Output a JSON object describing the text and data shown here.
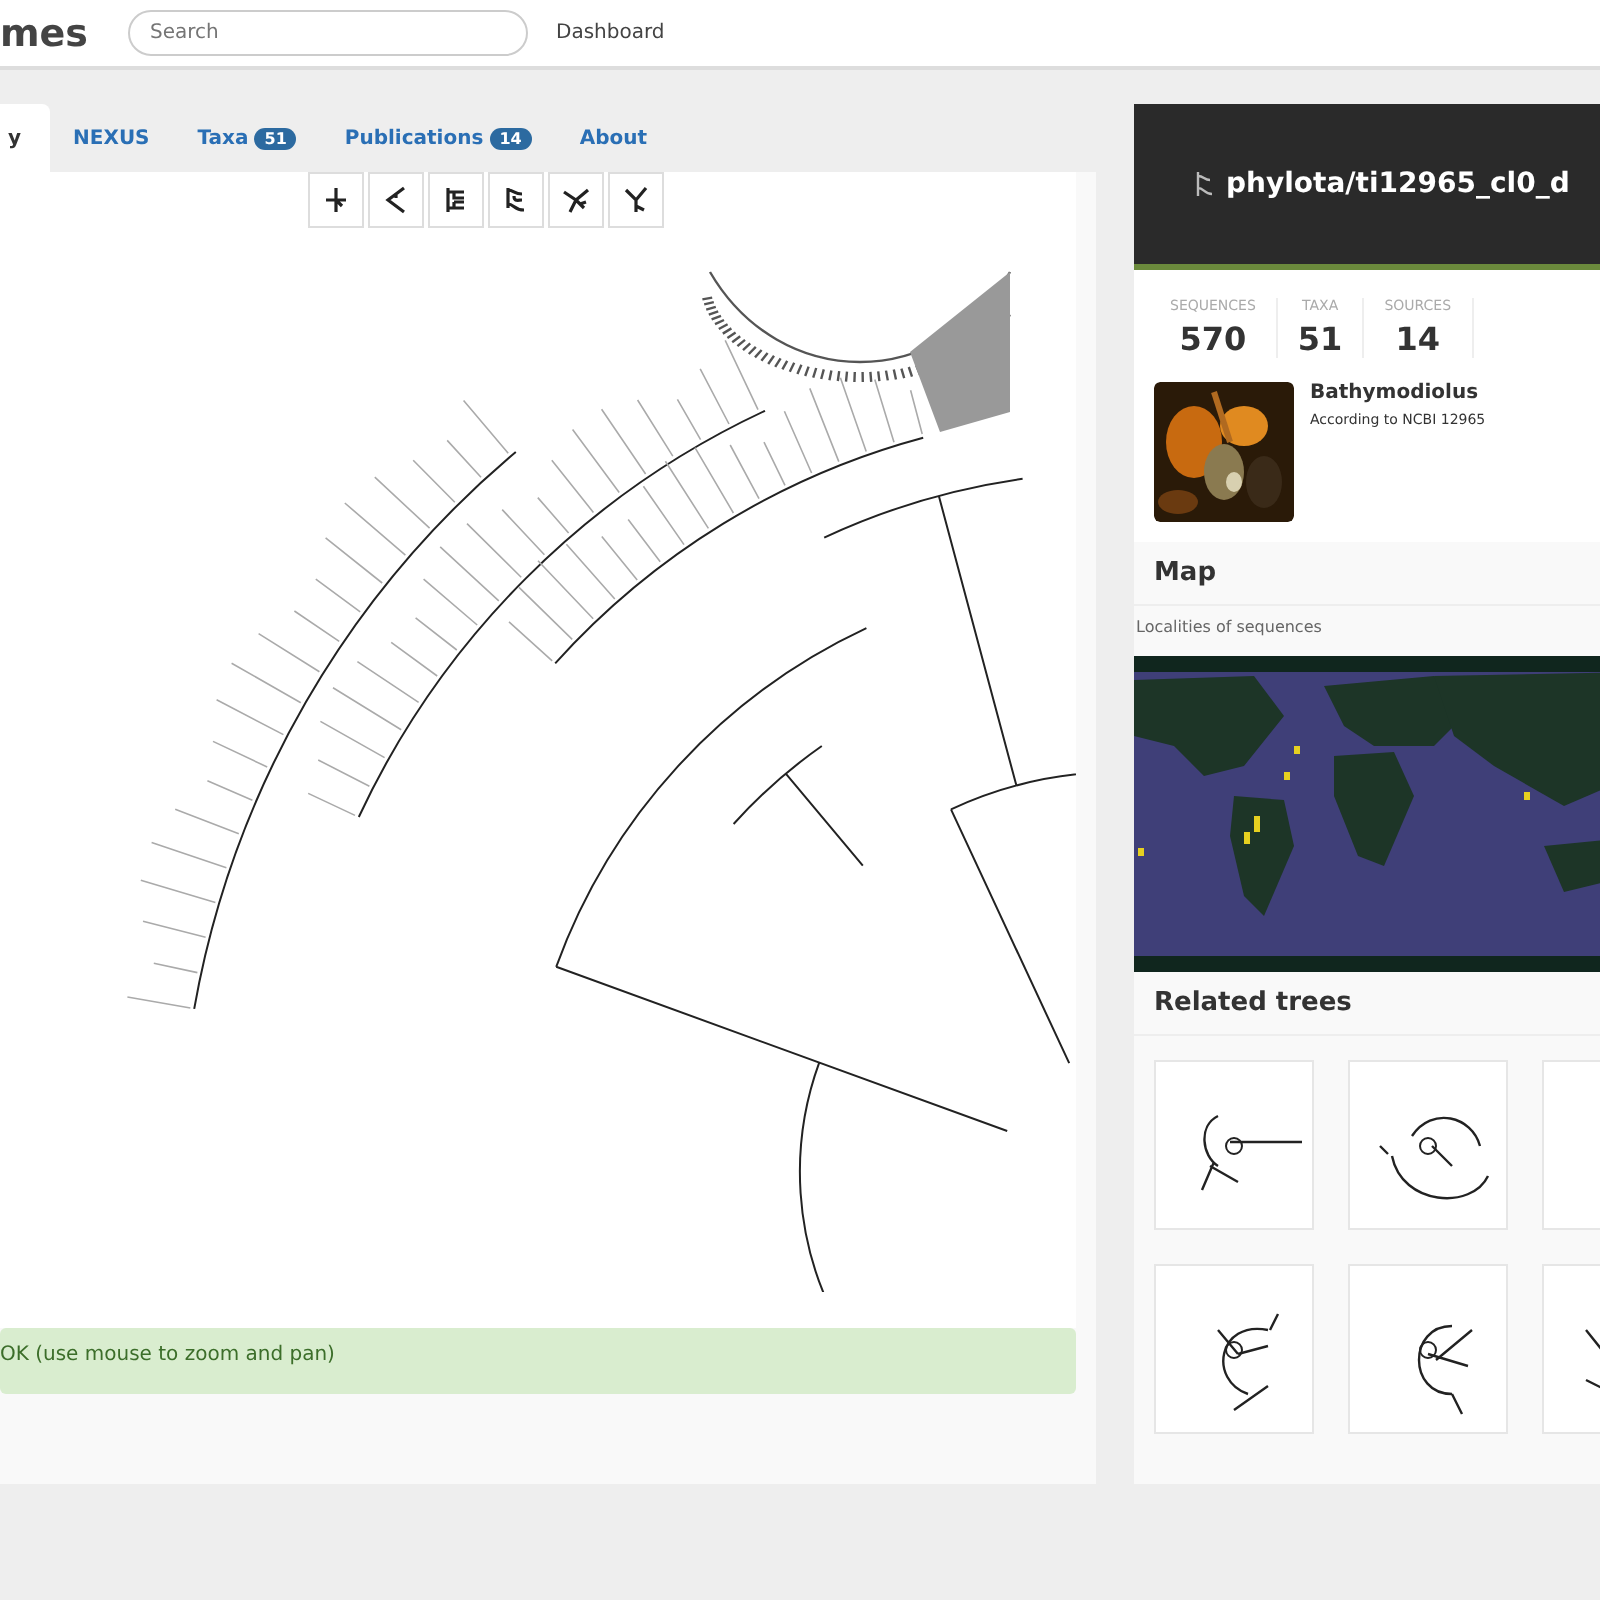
{
  "header": {
    "logo": "mes",
    "search": {
      "placeholder": "Search"
    },
    "nav": [
      "Dashboard"
    ]
  },
  "tabs": [
    {
      "label": "y",
      "selected": true
    },
    {
      "label": "NEXUS",
      "selected": false
    },
    {
      "label": "Taxa",
      "badge": "51",
      "selected": false
    },
    {
      "label": "Publications",
      "badge": "14",
      "selected": false
    },
    {
      "label": "About",
      "selected": false
    }
  ],
  "status": "OK (use mouse to zoom and pan)",
  "summary": {
    "title": "phylota/ti12965_cl0_d",
    "stats": [
      {
        "label": "SEQUENCES",
        "value": "570"
      },
      {
        "label": "TAXA",
        "value": "51"
      },
      {
        "label": "SOURCES",
        "value": "14"
      }
    ],
    "taxon": {
      "name": "Bathymodiolus",
      "source": "According to NCBI 12965"
    }
  },
  "map": {
    "title": "Map",
    "subtitle": "Localities of sequences"
  },
  "related": {
    "title": "Related trees"
  }
}
